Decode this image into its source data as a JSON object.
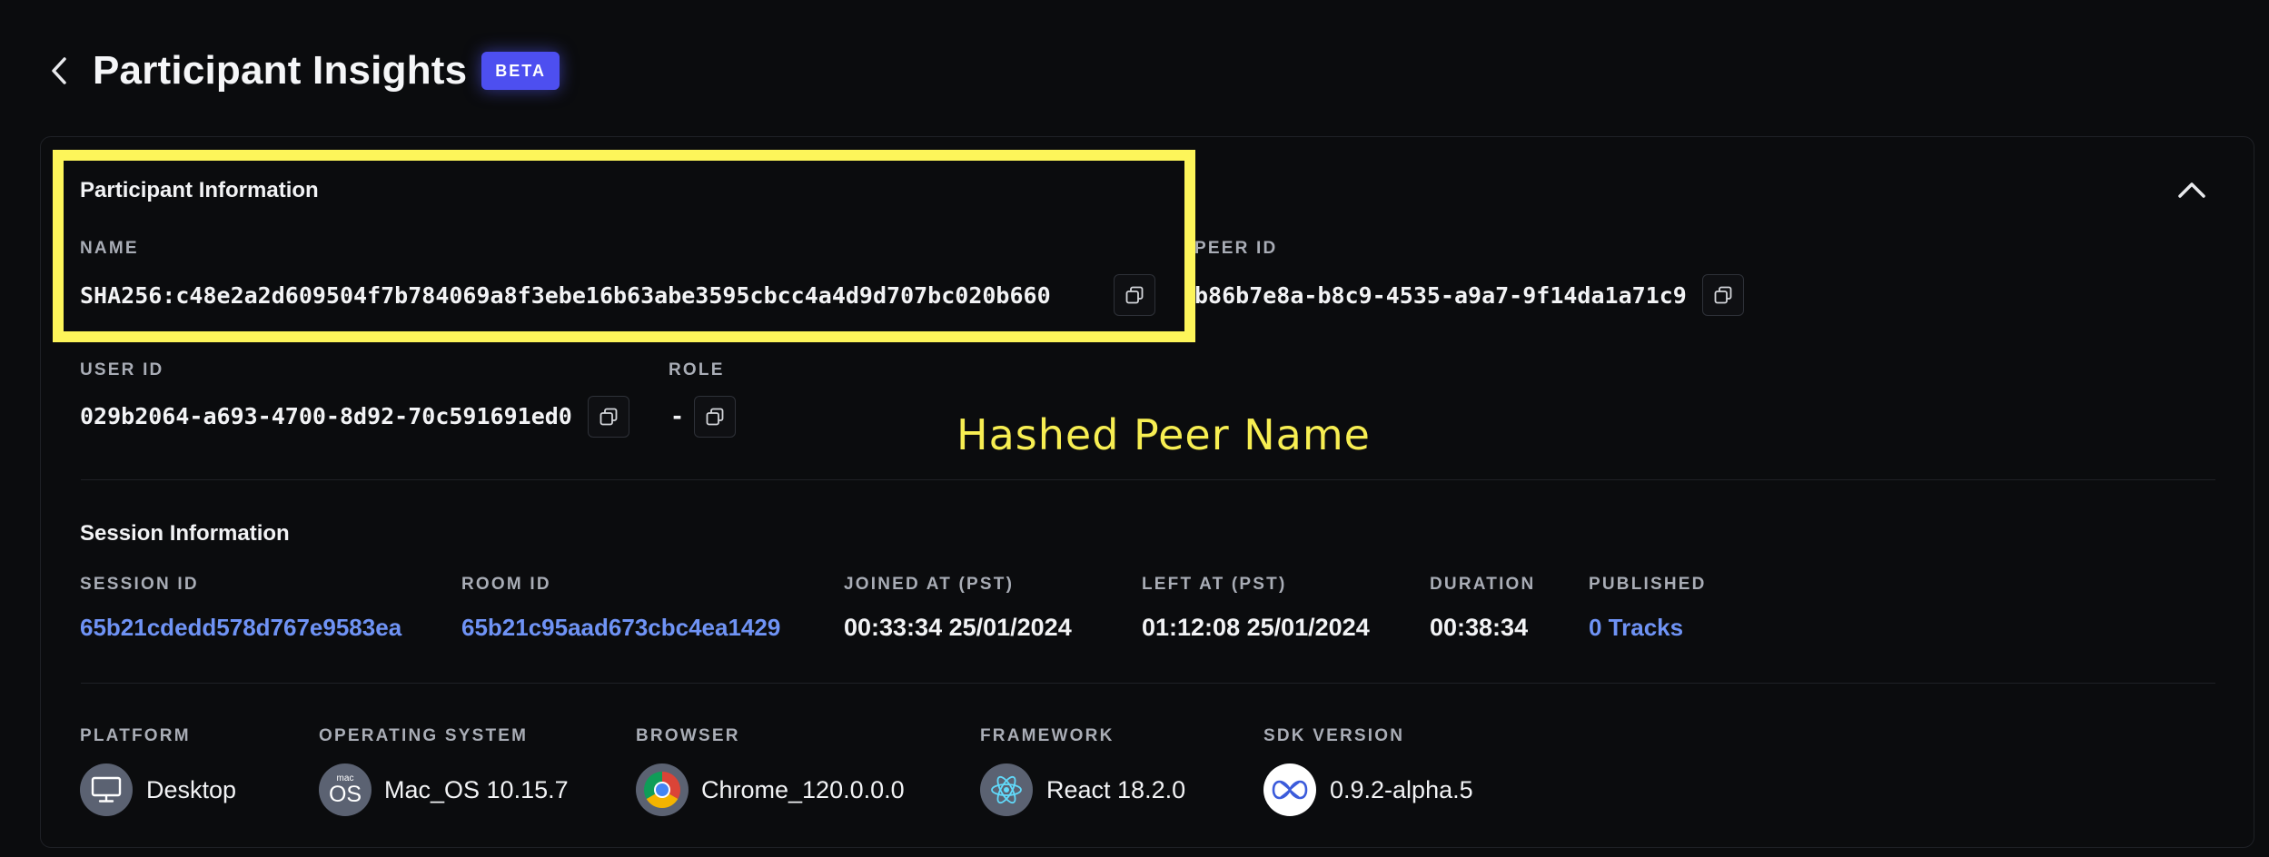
{
  "header": {
    "title": "Participant Insights",
    "badge": "BETA"
  },
  "participant_info": {
    "title": "Participant Information",
    "name_label": "NAME",
    "name_value": "SHA256:c48e2a2d609504f7b784069a8f3ebe16b63abe3595cbcc4a4d9d707bc020b660",
    "peer_id_label": "PEER ID",
    "peer_id_value": "b86b7e8a-b8c9-4535-a9a7-9f14da1a71c9",
    "user_id_label": "USER ID",
    "user_id_value": "029b2064-a693-4700-8d92-70c591691ed0",
    "role_label": "ROLE",
    "role_value": "-"
  },
  "session_info": {
    "title": "Session Information",
    "session_id_label": "SESSION ID",
    "session_id_value": "65b21cdedd578d767e9583ea",
    "room_id_label": "ROOM ID",
    "room_id_value": "65b21c95aad673cbc4ea1429",
    "joined_label": "JOINED AT (PST)",
    "joined_value": "00:33:34 25/01/2024",
    "left_label": "LEFT AT (PST)",
    "left_value": "01:12:08 25/01/2024",
    "duration_label": "DURATION",
    "duration_value": "00:38:34",
    "published_label": "PUBLISHED",
    "published_value": "0 Tracks"
  },
  "environment": {
    "platform_label": "PLATFORM",
    "platform_value": "Desktop",
    "os_label": "OPERATING SYSTEM",
    "os_value": "Mac_OS 10.15.7",
    "os_icon_small": "mac",
    "os_icon_big": "OS",
    "browser_label": "BROWSER",
    "browser_value": "Chrome_120.0.0.0",
    "framework_label": "FRAMEWORK",
    "framework_value": "React 18.2.0",
    "sdk_label": "SDK VERSION",
    "sdk_value": "0.9.2-alpha.5"
  },
  "annotation": {
    "text": "Hashed Peer Name"
  },
  "colors": {
    "background": "#0b0c0e",
    "accent_link": "#6f93f5",
    "badge": "#4d4ff0",
    "highlight": "#fdf55a"
  }
}
